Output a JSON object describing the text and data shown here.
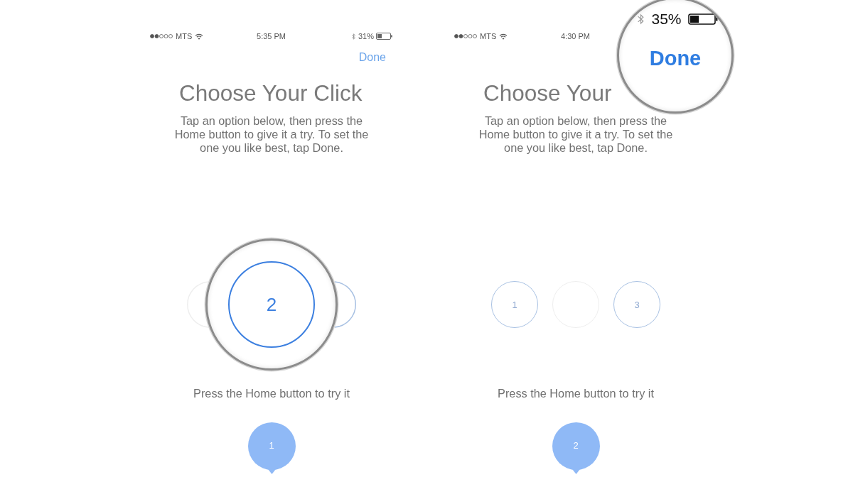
{
  "phones": [
    {
      "status_bar": {
        "carrier": "MTS",
        "time": "5:35 PM",
        "battery": "31%"
      },
      "done_button": "Done",
      "title": "Choose Your Click",
      "description": "Tap an option below, then press the\nHome button to give it a try. To set the\none you like best, tap Done.",
      "options": [
        {
          "selected": true,
          "magnified": false
        },
        {
          "label": "2",
          "selected": false,
          "magnified": true
        },
        {
          "selected": false,
          "magnified": false
        }
      ],
      "hint": "Press the Home button to try it",
      "indicator": "1"
    },
    {
      "status_bar": {
        "carrier": "MTS",
        "time": "4:30 PM"
      },
      "magnifier": {
        "kind": "status",
        "battery": "35%",
        "button": "Done"
      },
      "title": "Choose Your",
      "description": "Tap an option below, then press the\nHome button to give it a try. To set the\none you like best, tap Done.",
      "options": [
        {
          "label": "1",
          "selected": false,
          "magnified": false
        },
        {
          "selected": true,
          "magnified": false
        },
        {
          "label": "3",
          "selected": false,
          "magnified": false
        }
      ],
      "hint": "Press the Home button to try it",
      "indicator": "2"
    }
  ]
}
